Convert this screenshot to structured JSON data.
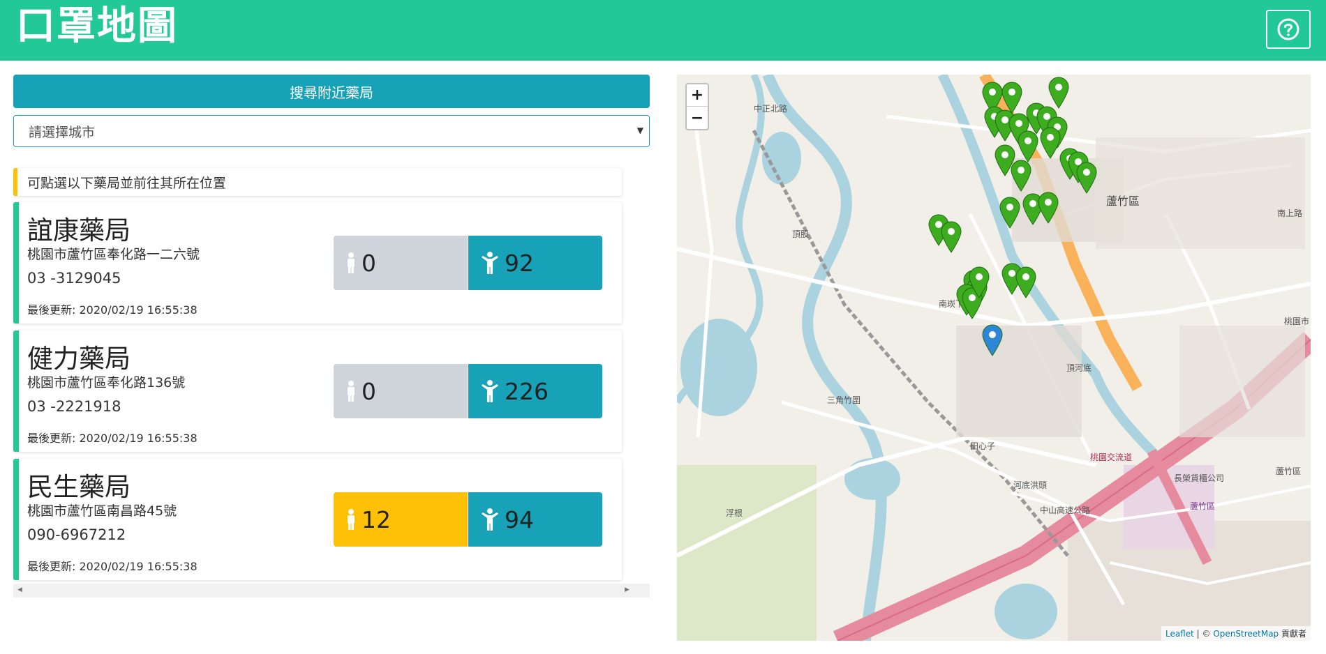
{
  "header": {
    "title": "口罩地圖",
    "help_icon": "question-circle-icon"
  },
  "search_button": "搜尋附近藥局",
  "city_select": {
    "value": "請選擇城市"
  },
  "notice": "可點選以下藥局並前往其所在位置",
  "pharmacies": [
    {
      "name": "誼康藥局",
      "address": "桃園市蘆竹區奉化路一二六號",
      "phone": "03 -3129045",
      "updated": "最後更新: 2020/02/19 16:55:38",
      "child": "0",
      "adult": "92",
      "child_warn": false
    },
    {
      "name": "健力藥局",
      "address": "桃園市蘆竹區奉化路136號",
      "phone": "03 -2221918",
      "updated": "最後更新: 2020/02/19 16:55:38",
      "child": "0",
      "adult": "226",
      "child_warn": false
    },
    {
      "name": "民生藥局",
      "address": "桃園市蘆竹區南昌路45號",
      "phone": "090-6967212",
      "updated": "最後更新: 2020/02/19 16:55:38",
      "child": "12",
      "adult": "94",
      "child_warn": true
    }
  ],
  "map": {
    "zoom_in": "+",
    "zoom_out": "−",
    "attribution_leaflet": "Leaflet",
    "attribution_sep": " | © ",
    "attribution_osm": "OpenStreetMap",
    "attribution_tail": " 貢獻者",
    "labels": [
      "中正北路",
      "頂股",
      "南崁下",
      "三角竹圍",
      "蘆竹區",
      "田心子",
      "河底洪頭",
      "桃園交流道",
      "中山高速公路",
      "長榮貨櫃公司",
      "浮根",
      "頂河底",
      "蘆竹區",
      "南上路",
      "桃園市",
      "蘆竹區"
    ],
    "colors": {
      "marker_green": "#3dad1f",
      "marker_blue": "#2e86d6",
      "highway": "#e68a9e",
      "river": "#aad3df"
    }
  }
}
